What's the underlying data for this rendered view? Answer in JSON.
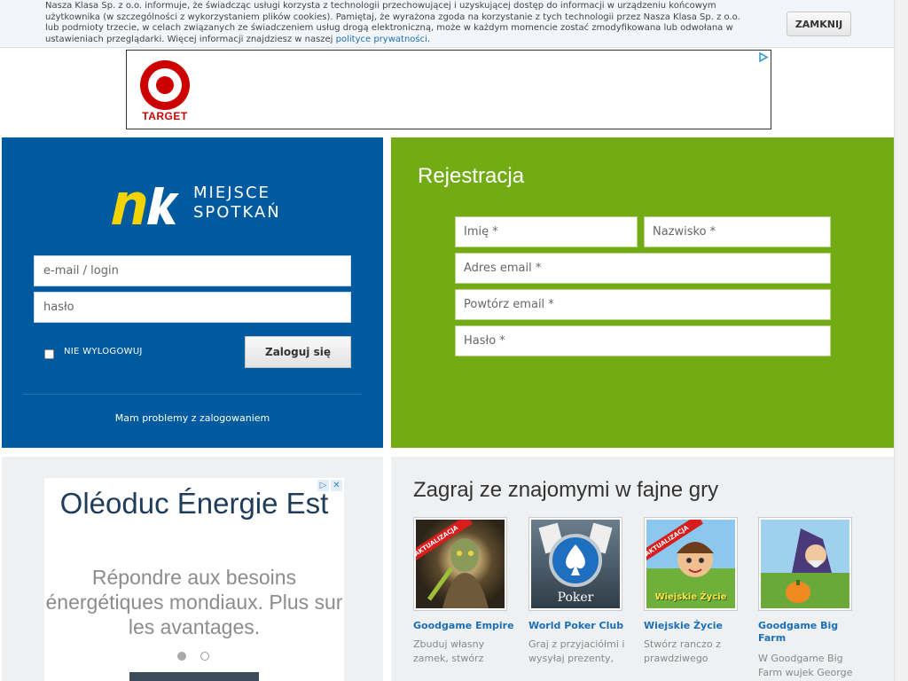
{
  "cookie": {
    "text_before_link": "Nasza Klasa Sp. z o.o. informuje, że świadcząc usługi korzysta z technologii przechowującej i uzyskującej dostęp do informacji w urządzeniu końcowym użytkownika (w szczególności z wykorzystaniem plików cookies). Pamiętaj, że wyrażona zgoda na korzystanie z tych technologii przez Nasza Klasa Sp. z o.o. lub podmioty trzecie, w celach związanych ze świadczeniem usług drogą elektroniczną, może w każdym momencie zostać zmodyfikowana lub odwołana w ustawieniach przeglądarki. Więcej informacji znajdziesz w naszej",
    "link": "polityce prywatności",
    "text_after_link": ".",
    "close_label": "ZAMKNIJ"
  },
  "top_ad": {
    "brand": "TARGET",
    "brand_color": "#cc0000"
  },
  "login": {
    "logo_text": "nk",
    "slogan_line1": "MIEJSCE",
    "slogan_line2": "SPOTKAŃ",
    "login_placeholder": "e-mail / login",
    "password_placeholder": "hasło",
    "remember_label": "NIE WYLOGOWUJ",
    "submit_label": "Zaloguj się",
    "problems_link": "Mam problemy z zalogowaniem",
    "bg_color": "#005aa0"
  },
  "registration": {
    "title": "Rejestracja",
    "first_name": "Imię *",
    "last_name": "Nazwisko *",
    "email": "Adres email *",
    "email_repeat": "Powtórz email *",
    "password": "Hasło *",
    "bg_color": "#73ab14"
  },
  "side_ad": {
    "title": "Oléoduc Énergie Est",
    "subtitle": "Répondre aux besoins énergétiques mondiaux. Plus sur les avantages."
  },
  "games": {
    "title": "Zagraj ze znajomymi w fajne gry",
    "badge": "AKTUALIZACJA",
    "items": [
      {
        "name": "Goodgame Empire",
        "desc": "Zbuduj własny zamek, stwórz"
      },
      {
        "name": "World Poker Club",
        "desc": "Graj z przyjaciółmi i wysyłaj prezenty,"
      },
      {
        "name": "Wiejskie Życie",
        "desc": "Stwórz ranczo z prawdziwego"
      },
      {
        "name": "Goodgame Big Farm",
        "desc": "W Goodgame Big Farm wujek George"
      }
    ],
    "poker_thumb_text": "Poker",
    "farm_thumb_text": "Wiejskie Życie"
  }
}
